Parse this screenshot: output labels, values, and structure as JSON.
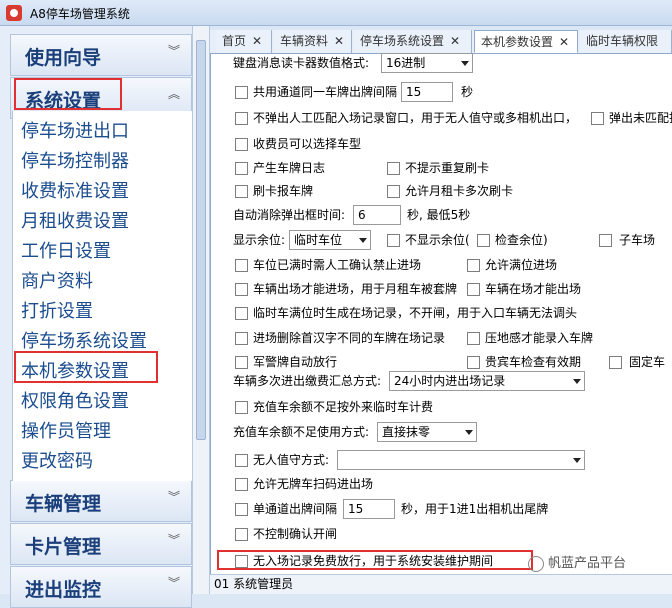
{
  "window": {
    "title": "A8停车场管理系统"
  },
  "sidebar": {
    "sections": [
      {
        "label": "使用向导"
      },
      {
        "label": "系统设置"
      },
      {
        "label": "车辆管理"
      },
      {
        "label": "卡片管理"
      },
      {
        "label": "进出监控"
      }
    ],
    "items": [
      {
        "label": "停车场进出口"
      },
      {
        "label": "停车场控制器"
      },
      {
        "label": "收费标准设置"
      },
      {
        "label": "月租收费设置"
      },
      {
        "label": "工作日设置"
      },
      {
        "label": "商户资料"
      },
      {
        "label": "打折设置"
      },
      {
        "label": "停车场系统设置"
      },
      {
        "label": "本机参数设置"
      },
      {
        "label": "权限角色设置"
      },
      {
        "label": "操作员管理"
      },
      {
        "label": "更改密码"
      }
    ]
  },
  "tabs": [
    {
      "label": "首页"
    },
    {
      "label": "车辆资料"
    },
    {
      "label": "停车场系统设置"
    },
    {
      "label": "本机参数设置"
    },
    {
      "label": "临时车辆权限"
    }
  ],
  "form": {
    "keyboard_format_label": "键盘消息读卡器数值格式:",
    "keyboard_format_value": "16进制",
    "shared_lane_label": "共用通道同一车牌出牌间隔",
    "shared_lane_value": "15",
    "shared_lane_unit": "秒",
    "no_popup_label": "不弹出人工匹配入场记录窗口，用于无人值守或多相机出口，",
    "popup_unmatched_label": "弹出未匹配找",
    "toll_select_label": "收费员可以选择车型",
    "gen_log_label": "产生车牌日志",
    "no_dup_label": "不提示重复刷卡",
    "swipe_report_label": "刷卡报车牌",
    "allow_monthly_label": "允许月租卡多次刷卡",
    "auto_close_label": "自动消除弹出框时间:",
    "auto_close_value": "6",
    "auto_close_unit": "秒, 最低5秒",
    "show_space_label": "显示余位:",
    "show_space_value": "临时车位",
    "hide_space_label": "不显示余位(",
    "check_space_label": "检查余位)",
    "child_lot_label": "子车场",
    "full_confirm_label": "车位已满时需人工确认禁止进场",
    "allow_full_label": "允许满位进场",
    "exit_to_enter_label": "车辆出场才能进场，用于月租车被套牌",
    "on_site_to_exit_label": "车辆在场才能出场",
    "temp_full_label": "临时车满位时生成在场记录，不开闸，用于入口车辆无法调头",
    "delete_diff_label": "进场删除首汉字不同的车牌在场记录",
    "pressure_label": "压地感才能录入车牌",
    "military_label": "军警牌自动放行",
    "vip_check_label": "贵宾车检查有效期",
    "fixed_car_label": "固定车",
    "multi_pay_label": "车辆多次进出缴费汇总方式:",
    "multi_pay_value": "24小时内进出场记录",
    "deduct_temp_label": "充值车余额不足按外来临时车计费",
    "insufficient_label": "充值车余额不足使用方式:",
    "insufficient_value": "直接抹零",
    "unmanned_label": "无人值守方式:",
    "unmanned_value": "",
    "no_plate_label": "允许无牌车扫码进出场",
    "single_lane_label": "单通道出牌间隔",
    "single_lane_value": "15",
    "single_lane_unit": "秒，用于1进1出相机出尾牌",
    "no_confirm_label": "不控制确认开闸",
    "free_pass_label": "无入场记录免费放行，用于系统安装维护期间"
  },
  "status": {
    "text": "01 系统管理员"
  },
  "watermark": {
    "text": "帆蓝产品平台"
  }
}
